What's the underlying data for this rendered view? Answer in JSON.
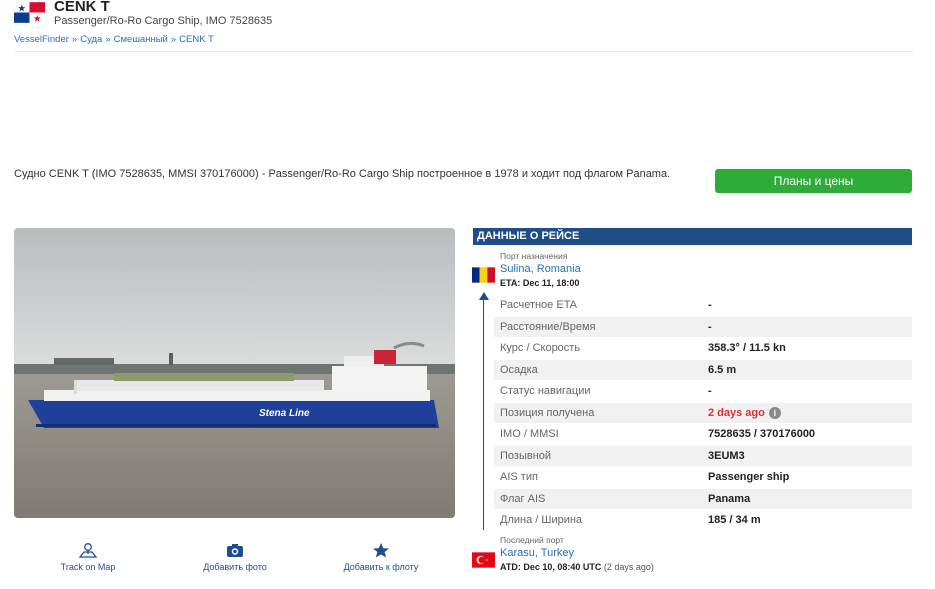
{
  "header": {
    "ship_name": "CENK T",
    "subtitle": "Passenger/Ro-Ro Cargo Ship, IMO 7528635",
    "flag_icon": "panama-flag-icon",
    "breadcrumbs": [
      "VesselFinder",
      "Суда",
      "Смешанный",
      "CENK T"
    ],
    "breadcrumb_separator": "»"
  },
  "description": "Судно CENK T (IMO 7528635, MMSI 370176000) - Passenger/Ro-Ro Cargo Ship построенное в 1978 и ходит под флагом Panama.",
  "plans_button": "Планы и цены",
  "photo": {
    "hull_text": "Stena Line"
  },
  "actions": [
    {
      "label": "Track on Map",
      "icon": "map-pin-icon"
    },
    {
      "label": "Добавить фото",
      "icon": "camera-icon"
    },
    {
      "label": "Добавить к флоту",
      "icon": "star-icon"
    }
  ],
  "voyage": {
    "title": "ДАННЫЕ О РЕЙСЕ",
    "destination": {
      "label": "Порт назначения",
      "port": "Sulina, Romania",
      "eta": "ETA: Dec 11, 18:00",
      "flag_icon": "romania-flag-icon"
    },
    "last_port": {
      "label": "Последний порт",
      "port": "Karasu, Turkey",
      "atd": "ATD: Dec 10, 08:40 UTC",
      "atd_relative": "(2 days ago)",
      "flag_icon": "turkey-flag-icon"
    },
    "rows": [
      {
        "key": "Расчетное ETA",
        "value": "-"
      },
      {
        "key": "Расстояние/Время",
        "value": "-"
      },
      {
        "key": "Курс / Скорость",
        "value": "358.3° / 11.5 kn"
      },
      {
        "key": "Осадка",
        "value": "6.5 m"
      },
      {
        "key": "Статус навигации",
        "value": "-"
      },
      {
        "key": "Позиция получена",
        "value": "2 days ago"
      },
      {
        "key": "IMO / MMSI",
        "value": "7528635 / 370176000"
      },
      {
        "key": "Позывной",
        "value": "3EUM3"
      },
      {
        "key": "AIS тип",
        "value": "Passenger ship"
      },
      {
        "key": "Флаг AIS",
        "value": "Panama"
      },
      {
        "key": "Длина / Ширина",
        "value": "185 / 34 m"
      }
    ]
  },
  "colors": {
    "accent_blue": "#1f4d85",
    "link_blue": "#2a6fb7",
    "button_green": "#2fab39",
    "alert_red": "#d9312f"
  }
}
